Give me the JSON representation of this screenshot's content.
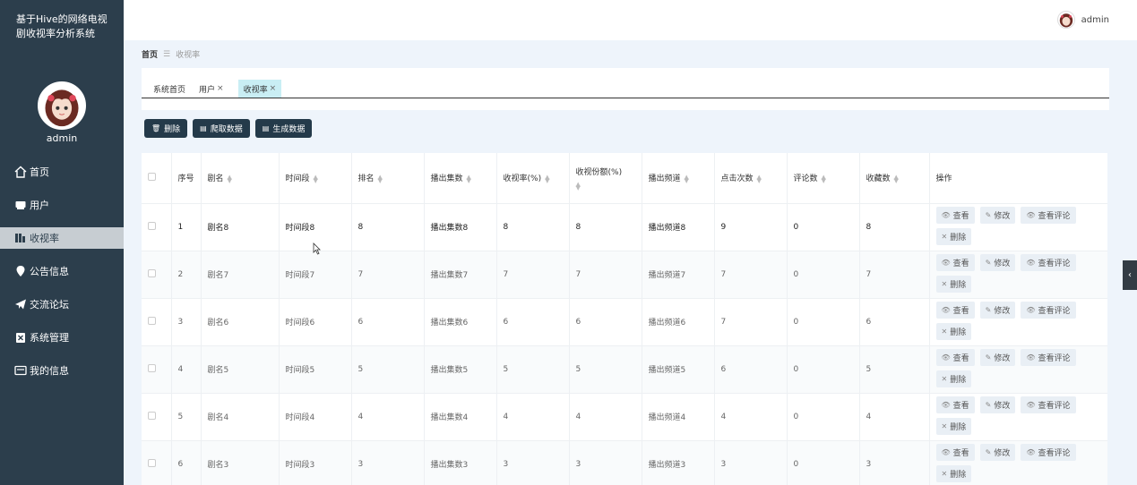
{
  "app": {
    "title": "基于Hive的网络电视剧收视率分析系统"
  },
  "sidebar": {
    "username": "admin",
    "items": [
      {
        "label": "首页",
        "icon": "home-icon",
        "active": false
      },
      {
        "label": "用户",
        "icon": "user-card-icon",
        "active": false
      },
      {
        "label": "收视率",
        "icon": "bar-chart-icon",
        "active": true
      },
      {
        "label": "公告信息",
        "icon": "location-pin-icon",
        "active": false
      },
      {
        "label": "交流论坛",
        "icon": "paper-plane-icon",
        "active": false
      },
      {
        "label": "系统管理",
        "icon": "clipboard-x-icon",
        "active": false
      },
      {
        "label": "我的信息",
        "icon": "id-card-icon",
        "active": false
      }
    ]
  },
  "header": {
    "username": "admin"
  },
  "breadcrumb": {
    "home": "首页",
    "separator": "☰",
    "current": "收视率"
  },
  "tabs": [
    {
      "label": "系统首页",
      "closable": false,
      "active": false
    },
    {
      "label": "用户",
      "closable": true,
      "active": false
    },
    {
      "label": "收视率",
      "closable": true,
      "active": true
    }
  ],
  "actions": {
    "delete": "删除",
    "crawl": "爬取数据",
    "generate": "生成数据"
  },
  "table": {
    "columns": [
      "序号",
      "剧名",
      "时间段",
      "排名",
      "播出集数",
      "收视率(%)",
      "收视份额(%)",
      "播出频道",
      "点击次数",
      "评论数",
      "收藏数",
      "操作"
    ],
    "rows": [
      [
        "1",
        "剧名8",
        "时间段8",
        "8",
        "播出集数8",
        "8",
        "8",
        "播出频道8",
        "9",
        "0",
        "8"
      ],
      [
        "2",
        "剧名7",
        "时间段7",
        "7",
        "播出集数7",
        "7",
        "7",
        "播出频道7",
        "7",
        "0",
        "7"
      ],
      [
        "3",
        "剧名6",
        "时间段6",
        "6",
        "播出集数6",
        "6",
        "6",
        "播出频道6",
        "7",
        "0",
        "6"
      ],
      [
        "4",
        "剧名5",
        "时间段5",
        "5",
        "播出集数5",
        "5",
        "5",
        "播出频道5",
        "6",
        "0",
        "5"
      ],
      [
        "5",
        "剧名4",
        "时间段4",
        "4",
        "播出集数4",
        "4",
        "4",
        "播出频道4",
        "4",
        "0",
        "4"
      ],
      [
        "6",
        "剧名3",
        "时间段3",
        "3",
        "播出集数3",
        "3",
        "3",
        "播出频道3",
        "3",
        "0",
        "3"
      ]
    ],
    "row_actions": {
      "view": "查看",
      "edit": "修改",
      "view_comments": "查看评论",
      "delete": "删除"
    }
  },
  "colors": {
    "sidebar_bg": "#2c3e4c",
    "accent": "#243a4a",
    "active_tab": "#c9eef4"
  }
}
